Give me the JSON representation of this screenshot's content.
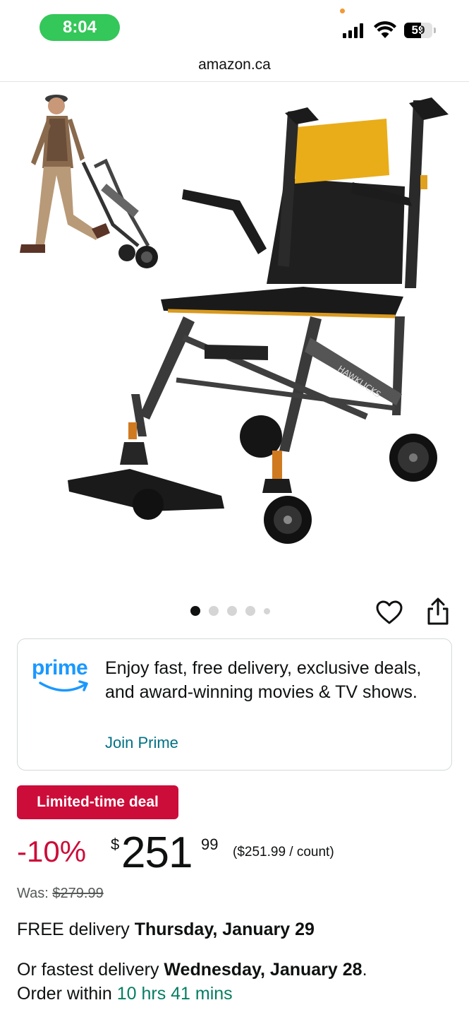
{
  "status_bar": {
    "time": "8:04",
    "battery": "59",
    "battery_level": 0.59,
    "icons": [
      "signal-icon",
      "wifi-icon",
      "battery-icon"
    ]
  },
  "browser": {
    "url": "amazon.ca"
  },
  "product": {
    "image_icon": "wheelchair-product-image",
    "carousel": {
      "count": 5,
      "active_index": 0
    },
    "actions": [
      "heart-icon",
      "share-icon"
    ]
  },
  "prime": {
    "logo_text": "prime",
    "description": "Enjoy fast, free delivery, exclusive deals, and award-winning movies & TV shows.",
    "join_label": "Join Prime"
  },
  "deal": {
    "badge": "Limited-time deal",
    "discount": "-10%",
    "currency": "$",
    "price_whole": "251",
    "price_fraction": "99",
    "unit_price": "($251.99 / count)",
    "was_label": "Was:",
    "was_price": "$279.99"
  },
  "delivery": {
    "free_prefix": "FREE delivery",
    "free_date": "Thursday, January 29",
    "fastest_prefix": "Or fastest delivery",
    "fastest_date": "Wednesday, January 28",
    "fastest_suffix": ".",
    "order_within": "Order within",
    "countdown": "10 hrs 41 mins"
  },
  "colors": {
    "prime_blue": "#1a98ff",
    "deal_red": "#cc0c39",
    "link_teal": "#007185",
    "countdown_green": "#067d62",
    "status_green": "#34c759"
  }
}
